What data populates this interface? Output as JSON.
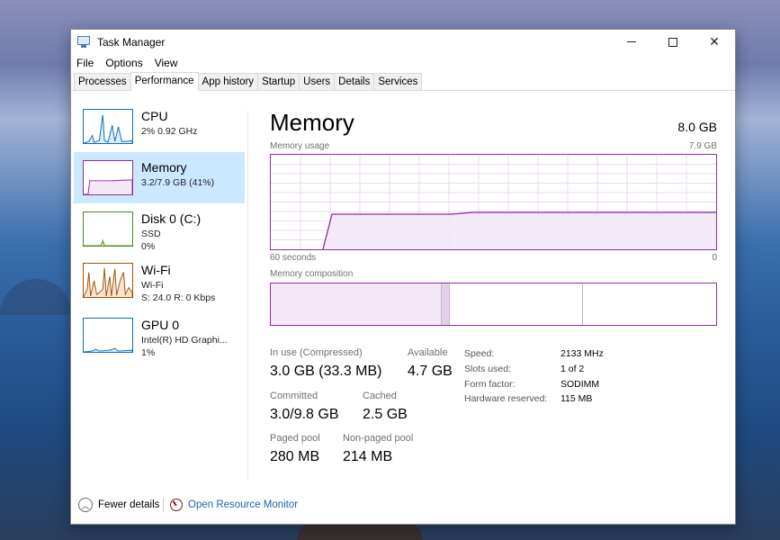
{
  "window": {
    "title": "Task Manager",
    "controls": {
      "minimize": "minimize",
      "maximize": "maximize",
      "close": "✕"
    }
  },
  "menu": [
    "File",
    "Options",
    "View"
  ],
  "tabs": [
    {
      "label": "Processes",
      "active": false
    },
    {
      "label": "Performance",
      "active": true
    },
    {
      "label": "App history",
      "active": false
    },
    {
      "label": "Startup",
      "active": false
    },
    {
      "label": "Users",
      "active": false
    },
    {
      "label": "Details",
      "active": false
    },
    {
      "label": "Services",
      "active": false
    }
  ],
  "sidebar": [
    {
      "title": "CPU",
      "lines": [
        "2%  0.92 GHz"
      ],
      "color": "#1170b3"
    },
    {
      "title": "Memory",
      "lines": [
        "3.2/7.9 GB (41%)"
      ],
      "color": "#8b2f9a"
    },
    {
      "title": "Disk 0 (C:)",
      "lines": [
        "SSD",
        "0%"
      ],
      "color": "#4d8a1f"
    },
    {
      "title": "Wi-Fi",
      "lines": [
        "Wi-Fi",
        "S: 24.0  R: 0 Kbps"
      ],
      "color": "#a74f01"
    },
    {
      "title": "GPU 0",
      "lines": [
        "Intel(R) HD Graphi...",
        "1%"
      ],
      "color": "#1170b3"
    }
  ],
  "main": {
    "title": "Memory",
    "total": "8.0 GB",
    "usage_label": "Memory usage",
    "usage_max": "7.9 GB",
    "time_left": "60 seconds",
    "time_right": "0",
    "composition_label": "Memory composition",
    "stats": {
      "in_use_label": "In use (Compressed)",
      "in_use_value": "3.0 GB (33.3 MB)",
      "available_label": "Available",
      "available_value": "4.7 GB",
      "committed_label": "Committed",
      "committed_value": "3.0/9.8 GB",
      "cached_label": "Cached",
      "cached_value": "2.5 GB",
      "paged_label": "Paged pool",
      "paged_value": "280 MB",
      "nonpaged_label": "Non-paged pool",
      "nonpaged_value": "214 MB"
    },
    "specs": [
      {
        "label": "Speed:",
        "value": "2133 MHz"
      },
      {
        "label": "Slots used:",
        "value": "1 of 2"
      },
      {
        "label": "Form factor:",
        "value": "SODIMM"
      },
      {
        "label": "Hardware reserved:",
        "value": "115 MB"
      }
    ]
  },
  "footer": {
    "fewer_details": "Fewer details",
    "open_monitor": "Open Resource Monitor"
  },
  "colors": {
    "memory": "#8b2f9a",
    "memory_fill": "#f4e8f6",
    "selected": "#cce8ff"
  }
}
